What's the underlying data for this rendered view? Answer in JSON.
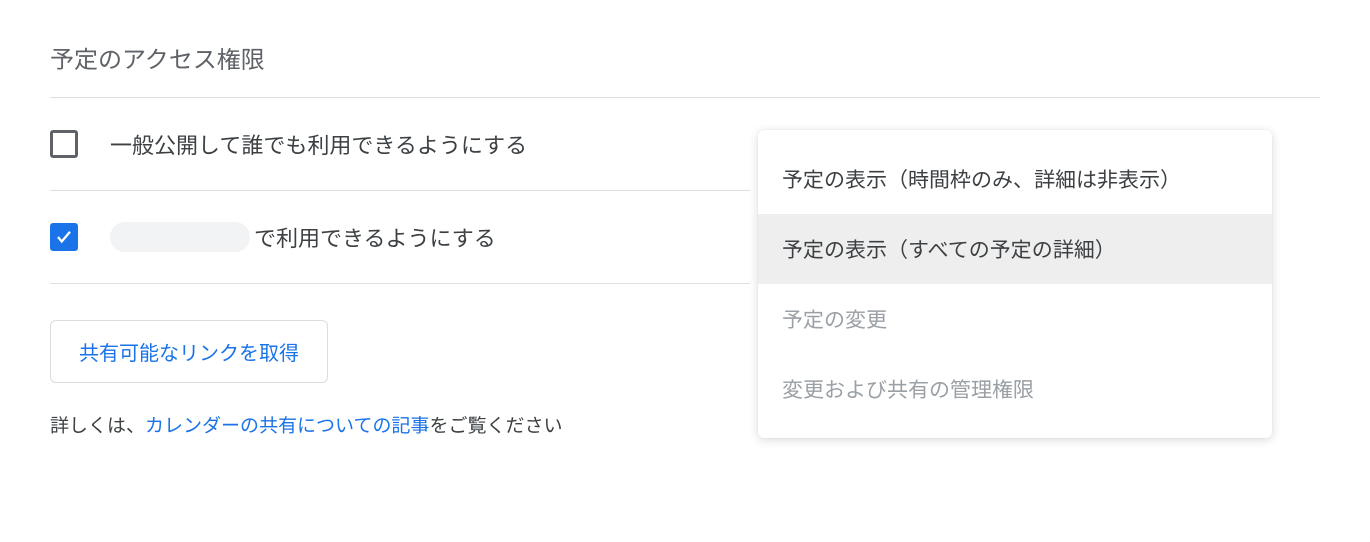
{
  "section": {
    "title": "予定のアクセス権限"
  },
  "options": {
    "public": {
      "label": "一般公開して誰でも利用できるようにする",
      "checked": false
    },
    "org": {
      "label_suffix": "で利用できるようにする",
      "checked": true
    }
  },
  "link_button": {
    "label": "共有可能なリンクを取得"
  },
  "help": {
    "prefix": "詳しくは、",
    "link": "カレンダーの共有についての記事",
    "suffix": "をご覧ください"
  },
  "dropdown": {
    "items": [
      {
        "label": "予定の表示（時間枠のみ、詳細は非表示）",
        "state": "enabled"
      },
      {
        "label": "予定の表示（すべての予定の詳細）",
        "state": "selected"
      },
      {
        "label": "予定の変更",
        "state": "disabled"
      },
      {
        "label": "変更および共有の管理権限",
        "state": "disabled"
      }
    ]
  }
}
